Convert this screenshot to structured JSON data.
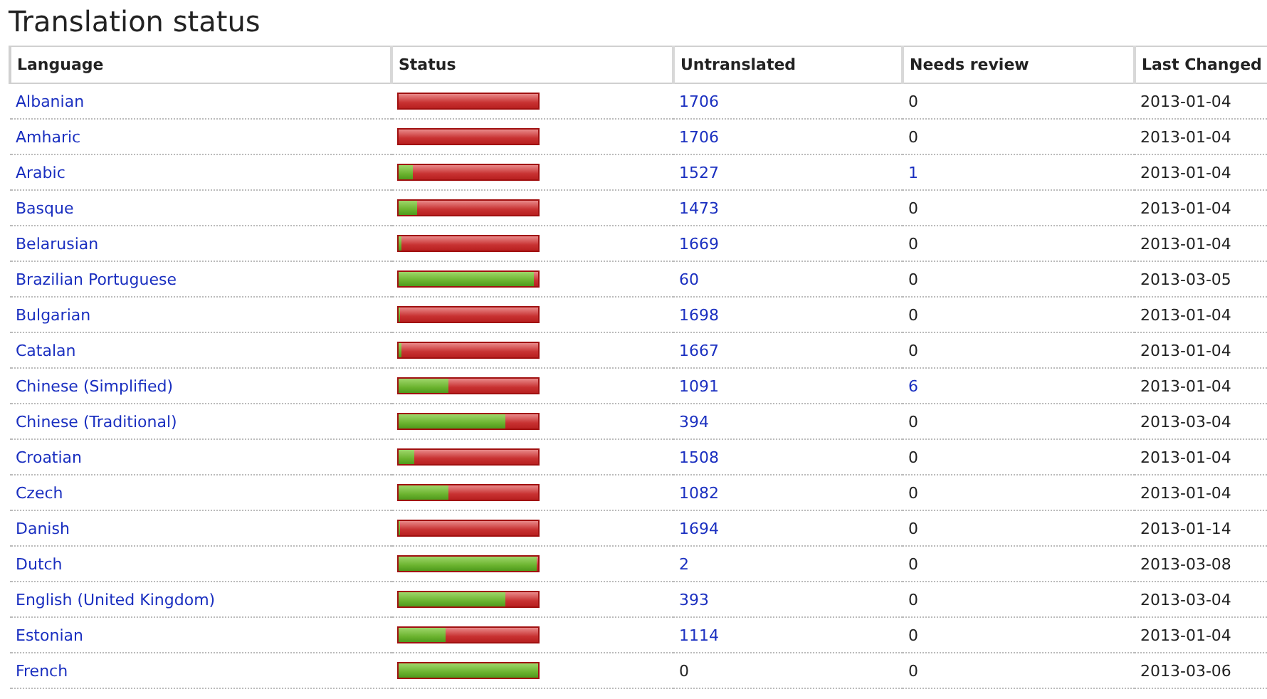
{
  "title": "Translation status",
  "table": {
    "columns": [
      "Language",
      "Status",
      "Untranslated",
      "Needs review",
      "Last Changed"
    ],
    "rows": [
      {
        "language": "Albanian",
        "level": 0,
        "untranslated": {
          "text": "1706",
          "link": true
        },
        "needs_review": {
          "text": "0",
          "link": false
        },
        "last_changed": "2013-01-04"
      },
      {
        "language": "Amharic",
        "level": 0,
        "untranslated": {
          "text": "1706",
          "link": true
        },
        "needs_review": {
          "text": "0",
          "link": false
        },
        "last_changed": "2013-01-04"
      },
      {
        "language": "Arabic",
        "level": 0.1,
        "untranslated": {
          "text": "1527",
          "link": true
        },
        "needs_review": {
          "text": "1",
          "link": true
        },
        "last_changed": "2013-01-04"
      },
      {
        "language": "Basque",
        "level": 0.13,
        "untranslated": {
          "text": "1473",
          "link": true
        },
        "needs_review": {
          "text": "0",
          "link": false
        },
        "last_changed": "2013-01-04"
      },
      {
        "language": "Belarusian",
        "level": 0.02,
        "untranslated": {
          "text": "1669",
          "link": true
        },
        "needs_review": {
          "text": "0",
          "link": false
        },
        "last_changed": "2013-01-04"
      },
      {
        "language": "Brazilian Portuguese",
        "level": 0.97,
        "untranslated": {
          "text": "60",
          "link": true
        },
        "needs_review": {
          "text": "0",
          "link": false
        },
        "last_changed": "2013-03-05"
      },
      {
        "language": "Bulgarian",
        "level": 0.01,
        "untranslated": {
          "text": "1698",
          "link": true
        },
        "needs_review": {
          "text": "0",
          "link": false
        },
        "last_changed": "2013-01-04"
      },
      {
        "language": "Catalan",
        "level": 0.02,
        "untranslated": {
          "text": "1667",
          "link": true
        },
        "needs_review": {
          "text": "0",
          "link": false
        },
        "last_changed": "2013-01-04"
      },
      {
        "language": "Chinese (Simplified)",
        "level": 0.36,
        "untranslated": {
          "text": "1091",
          "link": true
        },
        "needs_review": {
          "text": "6",
          "link": true
        },
        "last_changed": "2013-01-04"
      },
      {
        "language": "Chinese (Traditional)",
        "level": 0.77,
        "untranslated": {
          "text": "394",
          "link": true
        },
        "needs_review": {
          "text": "0",
          "link": false
        },
        "last_changed": "2013-03-04"
      },
      {
        "language": "Croatian",
        "level": 0.11,
        "untranslated": {
          "text": "1508",
          "link": true
        },
        "needs_review": {
          "text": "0",
          "link": false
        },
        "last_changed": "2013-01-04"
      },
      {
        "language": "Czech",
        "level": 0.36,
        "untranslated": {
          "text": "1082",
          "link": true
        },
        "needs_review": {
          "text": "0",
          "link": false
        },
        "last_changed": "2013-01-04"
      },
      {
        "language": "Danish",
        "level": 0.01,
        "untranslated": {
          "text": "1694",
          "link": true
        },
        "needs_review": {
          "text": "0",
          "link": false
        },
        "last_changed": "2013-01-14"
      },
      {
        "language": "Dutch",
        "level": 0.99,
        "untranslated": {
          "text": "2",
          "link": true
        },
        "needs_review": {
          "text": "0",
          "link": false
        },
        "last_changed": "2013-03-08"
      },
      {
        "language": "English (United Kingdom)",
        "level": 0.77,
        "untranslated": {
          "text": "393",
          "link": true
        },
        "needs_review": {
          "text": "0",
          "link": false
        },
        "last_changed": "2013-03-04"
      },
      {
        "language": "Estonian",
        "level": 0.34,
        "untranslated": {
          "text": "1114",
          "link": true
        },
        "needs_review": {
          "text": "0",
          "link": false
        },
        "last_changed": "2013-01-04"
      },
      {
        "language": "French",
        "level": 1,
        "untranslated": {
          "text": "0",
          "link": false
        },
        "needs_review": {
          "text": "0",
          "link": false
        },
        "last_changed": "2013-03-06"
      }
    ]
  }
}
